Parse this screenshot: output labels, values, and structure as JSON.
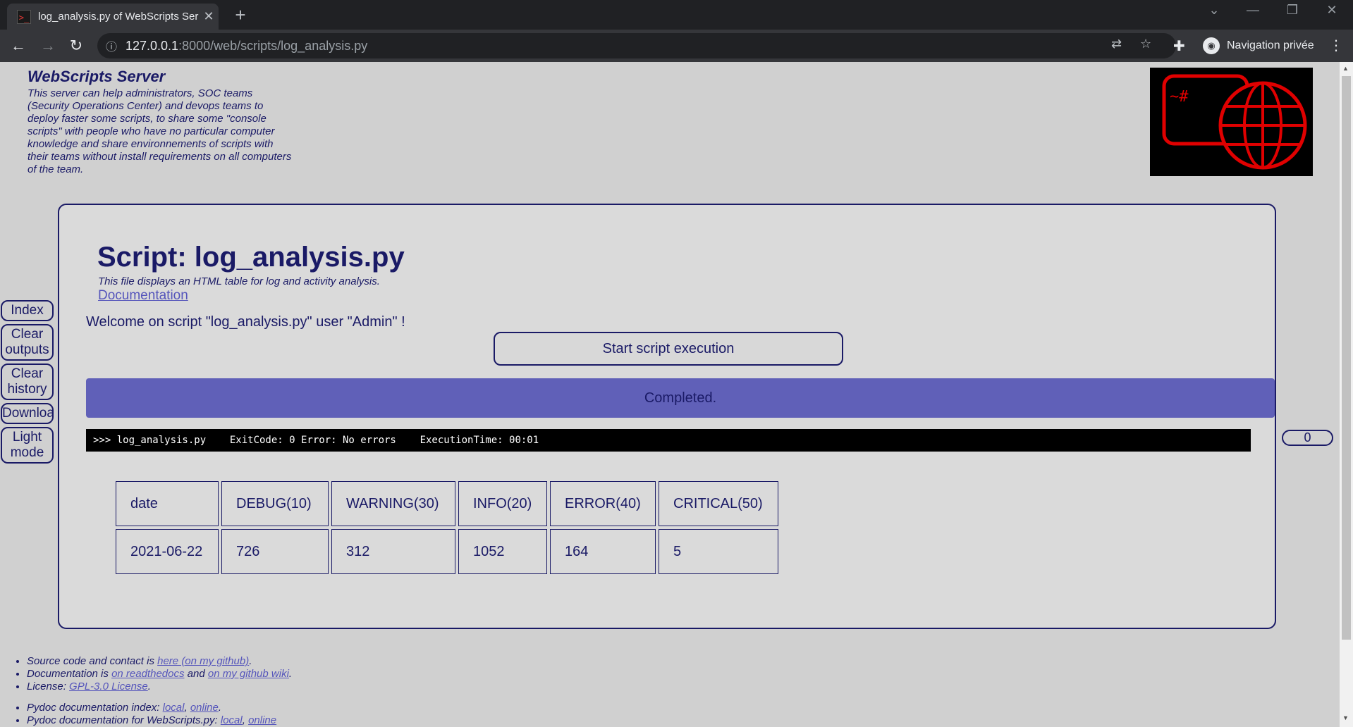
{
  "browser": {
    "tab_title": "log_analysis.py of WebScripts Ser",
    "tab_close": "✕",
    "new_tab": "+",
    "url_host": "127.0.0.1",
    "url_path": ":8000/web/scripts/log_analysis.py",
    "profile_label": "Navigation privée",
    "window_minimize": "—",
    "window_restore": "❐",
    "window_close": "✕"
  },
  "header": {
    "title": "WebScripts Server",
    "description": "This server can help administrators, SOC teams (Security Operations Center) and devops teams to deploy faster some scripts, to share some \"console scripts\" with people who have no particular computer knowledge and share environnements of scripts with their teams without install requirements on all computers of the team.",
    "logo_prompt": "~#"
  },
  "sidebar": {
    "items": [
      {
        "label": "Index"
      },
      {
        "label": "Clear outputs"
      },
      {
        "label": "Clear history"
      },
      {
        "label": "Download"
      },
      {
        "label": "Light mode"
      }
    ]
  },
  "counter": "0",
  "script": {
    "title": "Script: log_analysis.py",
    "description": "This file displays an HTML table for log and activity analysis.",
    "documentation_link": "Documentation",
    "welcome": "Welcome on script \"log_analysis.py\" user \"Admin\" !",
    "start_button": "Start script execution",
    "status": "Completed.",
    "console_line": ">>> log_analysis.py    ExitCode: 0 Error: No errors    ExecutionTime: 00:01"
  },
  "table": {
    "headers": [
      "date",
      "DEBUG(10)",
      "WARNING(30)",
      "INFO(20)",
      "ERROR(40)",
      "CRITICAL(50)"
    ],
    "rows": [
      [
        "2021-06-22",
        "726",
        "312",
        "1052",
        "164",
        "5"
      ]
    ]
  },
  "footer": {
    "source_prefix": "Source code and contact is ",
    "source_link": "here (on my github)",
    "source_suffix": ".",
    "doc_prefix": "Documentation is ",
    "doc_link1": "on readthedocs",
    "doc_and": " and ",
    "doc_link2": "on my github wiki",
    "doc_suffix": ".",
    "license_prefix": "License: ",
    "license_link": "GPL-3.0 License",
    "license_suffix": ".",
    "pydoc_prefix": "Pydoc documentation index: ",
    "pydoc_local": "local",
    "pydoc_sep": ", ",
    "pydoc_online": "online",
    "pydoc_suffix": ".",
    "pydoc2_prefix": "Pydoc documentation for WebScripts.py: ",
    "pydoc2_local": "local",
    "pydoc2_sep": ", ",
    "pydoc2_online": "online"
  }
}
